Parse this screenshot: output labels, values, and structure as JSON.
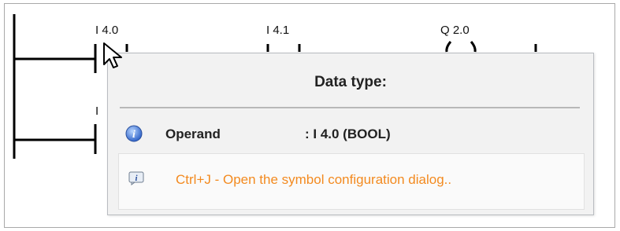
{
  "rungs": {
    "contact_1": {
      "operand": "I 4.0"
    },
    "contact_2": {
      "operand": "I 4.1"
    },
    "coil_1": {
      "operand": "Q 2.0"
    },
    "rung_2_partial_label": "I"
  },
  "tooltip": {
    "title": "Data type:",
    "info_icon": "info-circle-icon",
    "operand_label": "Operand",
    "operand_value": ": I 4.0 (BOOL)",
    "hint_icon": "info-note-icon",
    "hint_text": "Ctrl+J - Open the symbol configuration dialog..",
    "hint_color": "#f38a1f"
  },
  "cursor": "arrow-cursor-icon"
}
